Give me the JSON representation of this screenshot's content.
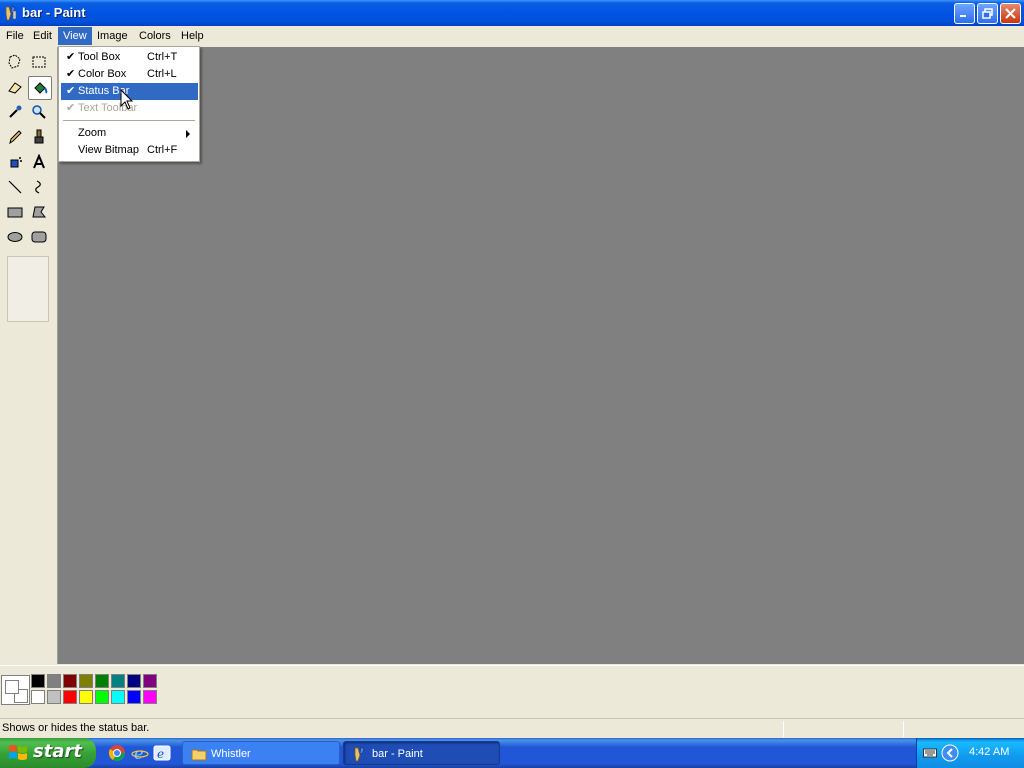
{
  "window": {
    "title": "bar - Paint",
    "icon": "paint-app-icon",
    "buttons": [
      "minimize-icon",
      "restore-icon",
      "close-icon"
    ]
  },
  "menubar": {
    "items": [
      {
        "label": "File"
      },
      {
        "label": "Edit"
      },
      {
        "label": "View"
      },
      {
        "label": "Image"
      },
      {
        "label": "Colors"
      },
      {
        "label": "Help"
      }
    ],
    "active": "View"
  },
  "view_menu": {
    "items": [
      {
        "label": "Tool Box",
        "shortcut": "Ctrl+T",
        "checked": true
      },
      {
        "label": "Color Box",
        "shortcut": "Ctrl+L",
        "checked": true
      },
      {
        "label": "Status Bar",
        "shortcut": "",
        "checked": true,
        "highlighted": true
      },
      {
        "label": "Text Toolbar",
        "shortcut": "",
        "checked": true,
        "disabled": true
      },
      {
        "label": "Zoom",
        "shortcut": "",
        "submenu": true
      },
      {
        "label": "View Bitmap",
        "shortcut": "Ctrl+F"
      }
    ]
  },
  "toolbox": {
    "tools": [
      "free-form-select-icon",
      "select-icon",
      "eraser-icon",
      "fill-icon",
      "pick-color-icon",
      "magnifier-icon",
      "pencil-icon",
      "brush-icon",
      "airbrush-icon",
      "text-icon",
      "line-icon",
      "curve-icon",
      "rectangle-icon",
      "polygon-icon",
      "ellipse-icon",
      "rounded-rectangle-icon"
    ],
    "selected": "fill-icon"
  },
  "colorbox": {
    "foreground": "#000000",
    "background": "#ffffff",
    "top_row": [
      "#000000",
      "#808080",
      "#800000",
      "#808000",
      "#008000",
      "#008080",
      "#000080",
      "#800080"
    ],
    "bottom_row": [
      "#ffffff",
      "#c0c0c0",
      "#ff0000",
      "#ffff00",
      "#00ff00",
      "#00ffff",
      "#0000ff",
      "#ff00ff"
    ]
  },
  "statusbar": {
    "text": "Shows or hides the status bar."
  },
  "taskbar": {
    "start_label": "start",
    "quick_launch": [
      "chrome-icon",
      "internet-explorer-icon",
      "outlook-express-icon"
    ],
    "tasks": [
      {
        "label": "Whistler",
        "icon": "folder-icon",
        "active": false
      },
      {
        "label": "bar - Paint",
        "icon": "paint-app-icon",
        "active": true
      }
    ],
    "tray_icons": [
      "keyboard-icon",
      "tray-expand-icon"
    ],
    "clock": "4:42 AM"
  }
}
